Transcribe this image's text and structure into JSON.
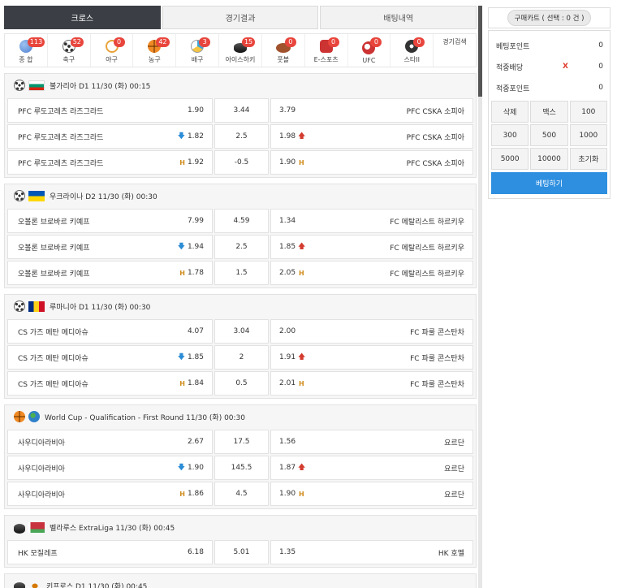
{
  "tabs": [
    "크로스",
    "경기결과",
    "배팅내역"
  ],
  "sports": [
    {
      "label": "종 합",
      "count": "113",
      "icon": "globe-icon",
      "color": "#4d7fd1"
    },
    {
      "label": "축구",
      "count": "52",
      "icon": "soccer-ball-icon",
      "color": "#666666"
    },
    {
      "label": "야구",
      "count": "0",
      "icon": "baseball-icon",
      "color": "#e8a33b"
    },
    {
      "label": "농구",
      "count": "42",
      "icon": "basketball-icon",
      "color": "#f08a24"
    },
    {
      "label": "배구",
      "count": "3",
      "icon": "volleyball-icon",
      "color": "#3fa7d6"
    },
    {
      "label": "아이스하키",
      "count": "15",
      "icon": "hockey-puck-icon",
      "color": "#222222"
    },
    {
      "label": "풋볼",
      "count": "0",
      "icon": "american-football-icon",
      "color": "#a0522d"
    },
    {
      "label": "E-스포츠",
      "count": "0",
      "icon": "esports-icon",
      "color": "#cc3333"
    },
    {
      "label": "UFC",
      "count": "0",
      "icon": "ufc-icon",
      "color": "#cc3333"
    },
    {
      "label": "스타II",
      "count": "0",
      "icon": "starcraft-icon",
      "color": "#333333"
    }
  ],
  "search_label": "경기검색",
  "leagues": [
    {
      "icon": "soccer-ball-icon",
      "flag": [
        "#ffffff",
        "#00966e",
        "#d62612"
      ],
      "flag_dir": "h",
      "title": "불가리아 D1 11/30 (화) 00:15",
      "rows": [
        {
          "home": "PFC 루도고레츠 라즈그라드",
          "home_odds": "1.90",
          "mid": "3.44",
          "away_odds": "3.79",
          "away": "PFC CSKA 소피아",
          "mark": ""
        },
        {
          "home": "PFC 루도고레츠 라즈그라드",
          "home_odds": "1.82",
          "mid": "2.5",
          "away_odds": "1.98",
          "away": "PFC CSKA 소피아",
          "mark": "ou"
        },
        {
          "home": "PFC 루도고레츠 라즈그라드",
          "home_odds": "1.92",
          "mid": "-0.5",
          "away_odds": "1.90",
          "away": "PFC CSKA 소피아",
          "mark": "h"
        }
      ]
    },
    {
      "icon": "soccer-ball-icon",
      "flag": [
        "#0057b7",
        "#ffd700"
      ],
      "flag_dir": "h",
      "title": "우크라이나 D2 11/30 (화) 00:30",
      "rows": [
        {
          "home": "오볼론 브로바르 키예프",
          "home_odds": "7.99",
          "mid": "4.59",
          "away_odds": "1.34",
          "away": "FC 메탈리스트 하르키우",
          "mark": ""
        },
        {
          "home": "오볼론 브로바르 키예프",
          "home_odds": "1.94",
          "mid": "2.5",
          "away_odds": "1.85",
          "away": "FC 메탈리스트 하르키우",
          "mark": "ou"
        },
        {
          "home": "오볼론 브로바르 키예프",
          "home_odds": "1.78",
          "mid": "1.5",
          "away_odds": "2.05",
          "away": "FC 메탈리스트 하르키우",
          "mark": "h"
        }
      ]
    },
    {
      "icon": "soccer-ball-icon",
      "flag": [
        "#002b7f",
        "#fcd116",
        "#ce1126"
      ],
      "flag_dir": "v",
      "title": "루마니아 D1 11/30 (화) 00:30",
      "rows": [
        {
          "home": "CS 가즈 메탄 메디아슈",
          "home_odds": "4.07",
          "mid": "3.04",
          "away_odds": "2.00",
          "away": "FC 파룰 콘스탄차",
          "mark": ""
        },
        {
          "home": "CS 가즈 메탄 메디아슈",
          "home_odds": "1.85",
          "mid": "2",
          "away_odds": "1.91",
          "away": "FC 파룰 콘스탄차",
          "mark": "ou"
        },
        {
          "home": "CS 가즈 메탄 메디아슈",
          "home_odds": "1.84",
          "mid": "0.5",
          "away_odds": "2.01",
          "away": "FC 파룰 콘스탄차",
          "mark": "h"
        }
      ]
    },
    {
      "icon": "basketball-icon",
      "flag": [
        "#2f80c9",
        "#4caf50"
      ],
      "flag_dir": "globe",
      "title": "World Cup - Qualification - First Round 11/30 (화) 00:30",
      "rows": [
        {
          "home": "사우디아라비아",
          "home_odds": "2.67",
          "mid": "17.5",
          "away_odds": "1.56",
          "away": "요르단",
          "mark": ""
        },
        {
          "home": "사우디아라비아",
          "home_odds": "1.90",
          "mid": "145.5",
          "away_odds": "1.87",
          "away": "요르단",
          "mark": "ou"
        },
        {
          "home": "사우디아라비아",
          "home_odds": "1.86",
          "mid": "4.5",
          "away_odds": "1.90",
          "away": "요르단",
          "mark": "h"
        }
      ]
    },
    {
      "icon": "hockey-puck-icon",
      "flag": [
        "#c8313e",
        "#4aa657"
      ],
      "flag_dir": "h2",
      "title": "벨라루스 ExtraLiga 11/30 (화) 00:45",
      "rows": [
        {
          "home": "HK 모질레프",
          "home_odds": "6.18",
          "mid": "5.01",
          "away_odds": "1.35",
          "away": "HK 호멜",
          "mark": ""
        }
      ]
    },
    {
      "icon": "hockey-puck-icon",
      "flag": [
        "#ffffff",
        "#d57800"
      ],
      "flag_dir": "cy",
      "title": "키프로스 D1 11/30 (화) 00:45",
      "rows": []
    }
  ],
  "cart": {
    "title": "구매카트 ( 선택 : 0 건 )",
    "bet_points_label": "베팅포인트",
    "bet_points_value": "0",
    "odds_label": "적중배당",
    "odds_mark": "X",
    "odds_value": "0",
    "win_points_label": "적중포인트",
    "win_points_value": "0",
    "buttons": [
      "삭제",
      "맥스",
      "100",
      "300",
      "500",
      "1000",
      "5000",
      "10000",
      "초기화"
    ],
    "bet_button": "베팅하기"
  },
  "colors": {
    "accent": "#2e8fe0",
    "badge": "#e8453c",
    "up": "#d33b2e",
    "down": "#2b8cd6",
    "handicap": "#d08c1c"
  }
}
